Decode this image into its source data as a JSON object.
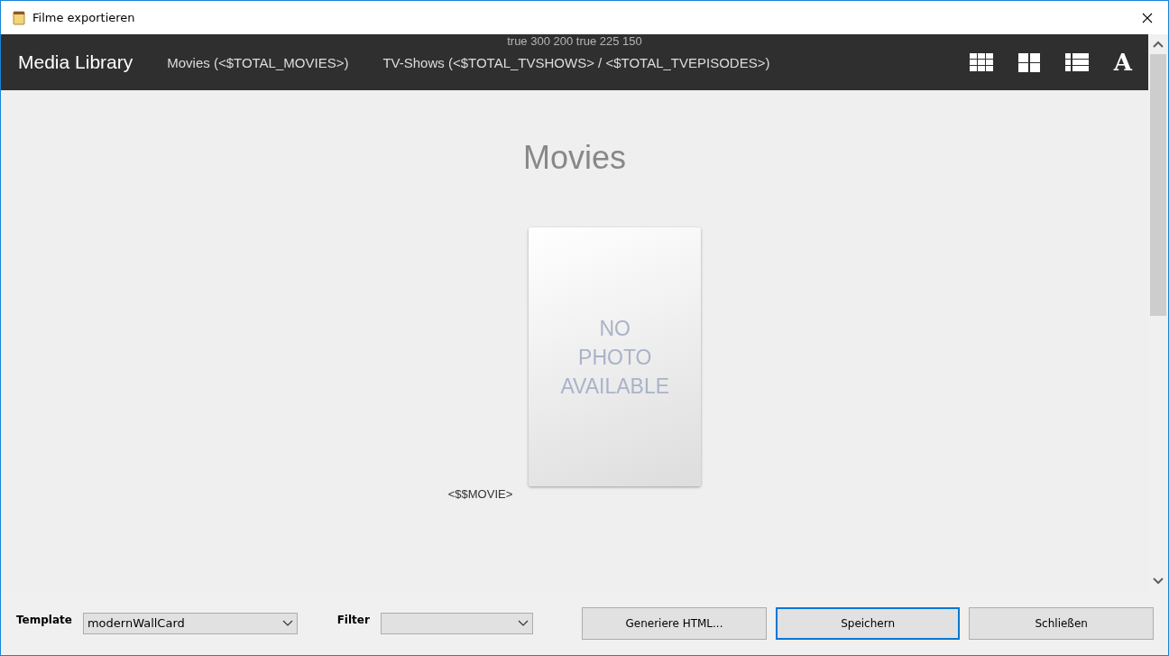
{
  "window": {
    "title": "Filme exportieren"
  },
  "preview": {
    "debug_text": "true 300 200 true 225 150",
    "brand": "Media Library",
    "nav_links": [
      "Movies (<$TOTAL_MOVIES>)",
      "TV-Shows (<$TOTAL_TVSHOWS> / <$TOTAL_TVEPISODES>)"
    ],
    "view_buttons": [
      {
        "kind": "grid"
      },
      {
        "kind": "tiles"
      },
      {
        "kind": "list"
      },
      {
        "kind": "font",
        "label": "A"
      }
    ],
    "heading": "Movies",
    "card": {
      "placeholder_lines": [
        "NO",
        "PHOTO",
        "AVAILABLE"
      ],
      "caption": "<$$MOVIE>"
    }
  },
  "template": {
    "label": "Template",
    "value": "modernWallCard"
  },
  "filter": {
    "label": "Filter"
  },
  "buttons": [
    {
      "label": "Generiere HTML...",
      "focused": false
    },
    {
      "label": "Speichern",
      "focused": true
    },
    {
      "label": "Schließen",
      "focused": false
    }
  ]
}
